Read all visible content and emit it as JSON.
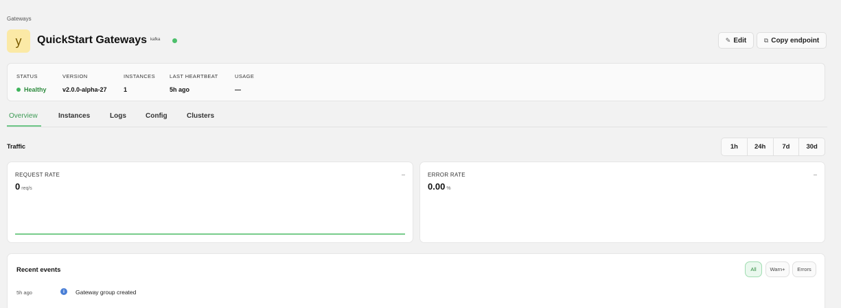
{
  "breadcrumb": "Gateways",
  "header": {
    "logo_glyph": "y",
    "title": "QuickStart Gateways",
    "tag": "kafka",
    "status_color": "#4cbf6b",
    "edit_label": "Edit",
    "edit_icon": "pencil-icon",
    "copy_label": "Copy endpoint",
    "copy_icon": "copy-icon"
  },
  "summary": {
    "status": {
      "label": "STATUS",
      "value": "Healthy"
    },
    "version": {
      "label": "VERSION",
      "value": "v2.0.0-alpha-27"
    },
    "instances": {
      "label": "INSTANCES",
      "value": "1"
    },
    "heartbeat": {
      "label": "LAST HEARTBEAT",
      "value": "5h ago"
    },
    "usage": {
      "label": "USAGE",
      "value": "—"
    }
  },
  "tabs": [
    {
      "label": "Overview",
      "active": true
    },
    {
      "label": "Instances",
      "active": false
    },
    {
      "label": "Logs",
      "active": false
    },
    {
      "label": "Config",
      "active": false
    },
    {
      "label": "Clusters",
      "active": false
    }
  ],
  "traffic": {
    "title": "Traffic",
    "ranges": [
      "1h",
      "24h",
      "7d",
      "30d"
    ]
  },
  "request_rate": {
    "label": "REQUEST RATE",
    "value": "0",
    "unit": "req/s",
    "dash": "–"
  },
  "error_rate": {
    "label": "ERROR RATE",
    "value": "0.00",
    "unit": "%",
    "dash": "–"
  },
  "events": {
    "title": "Recent events",
    "filters": [
      "All",
      "Warn+",
      "Errors"
    ],
    "active_filter": "All",
    "rows": [
      {
        "time": "5h ago",
        "icon": "info-icon",
        "text": "Gateway group created"
      }
    ]
  },
  "colors": {
    "accent_green": "#3d9b55",
    "logo_bg": "#fbe9a6",
    "info_blue": "#4a7fd6"
  }
}
